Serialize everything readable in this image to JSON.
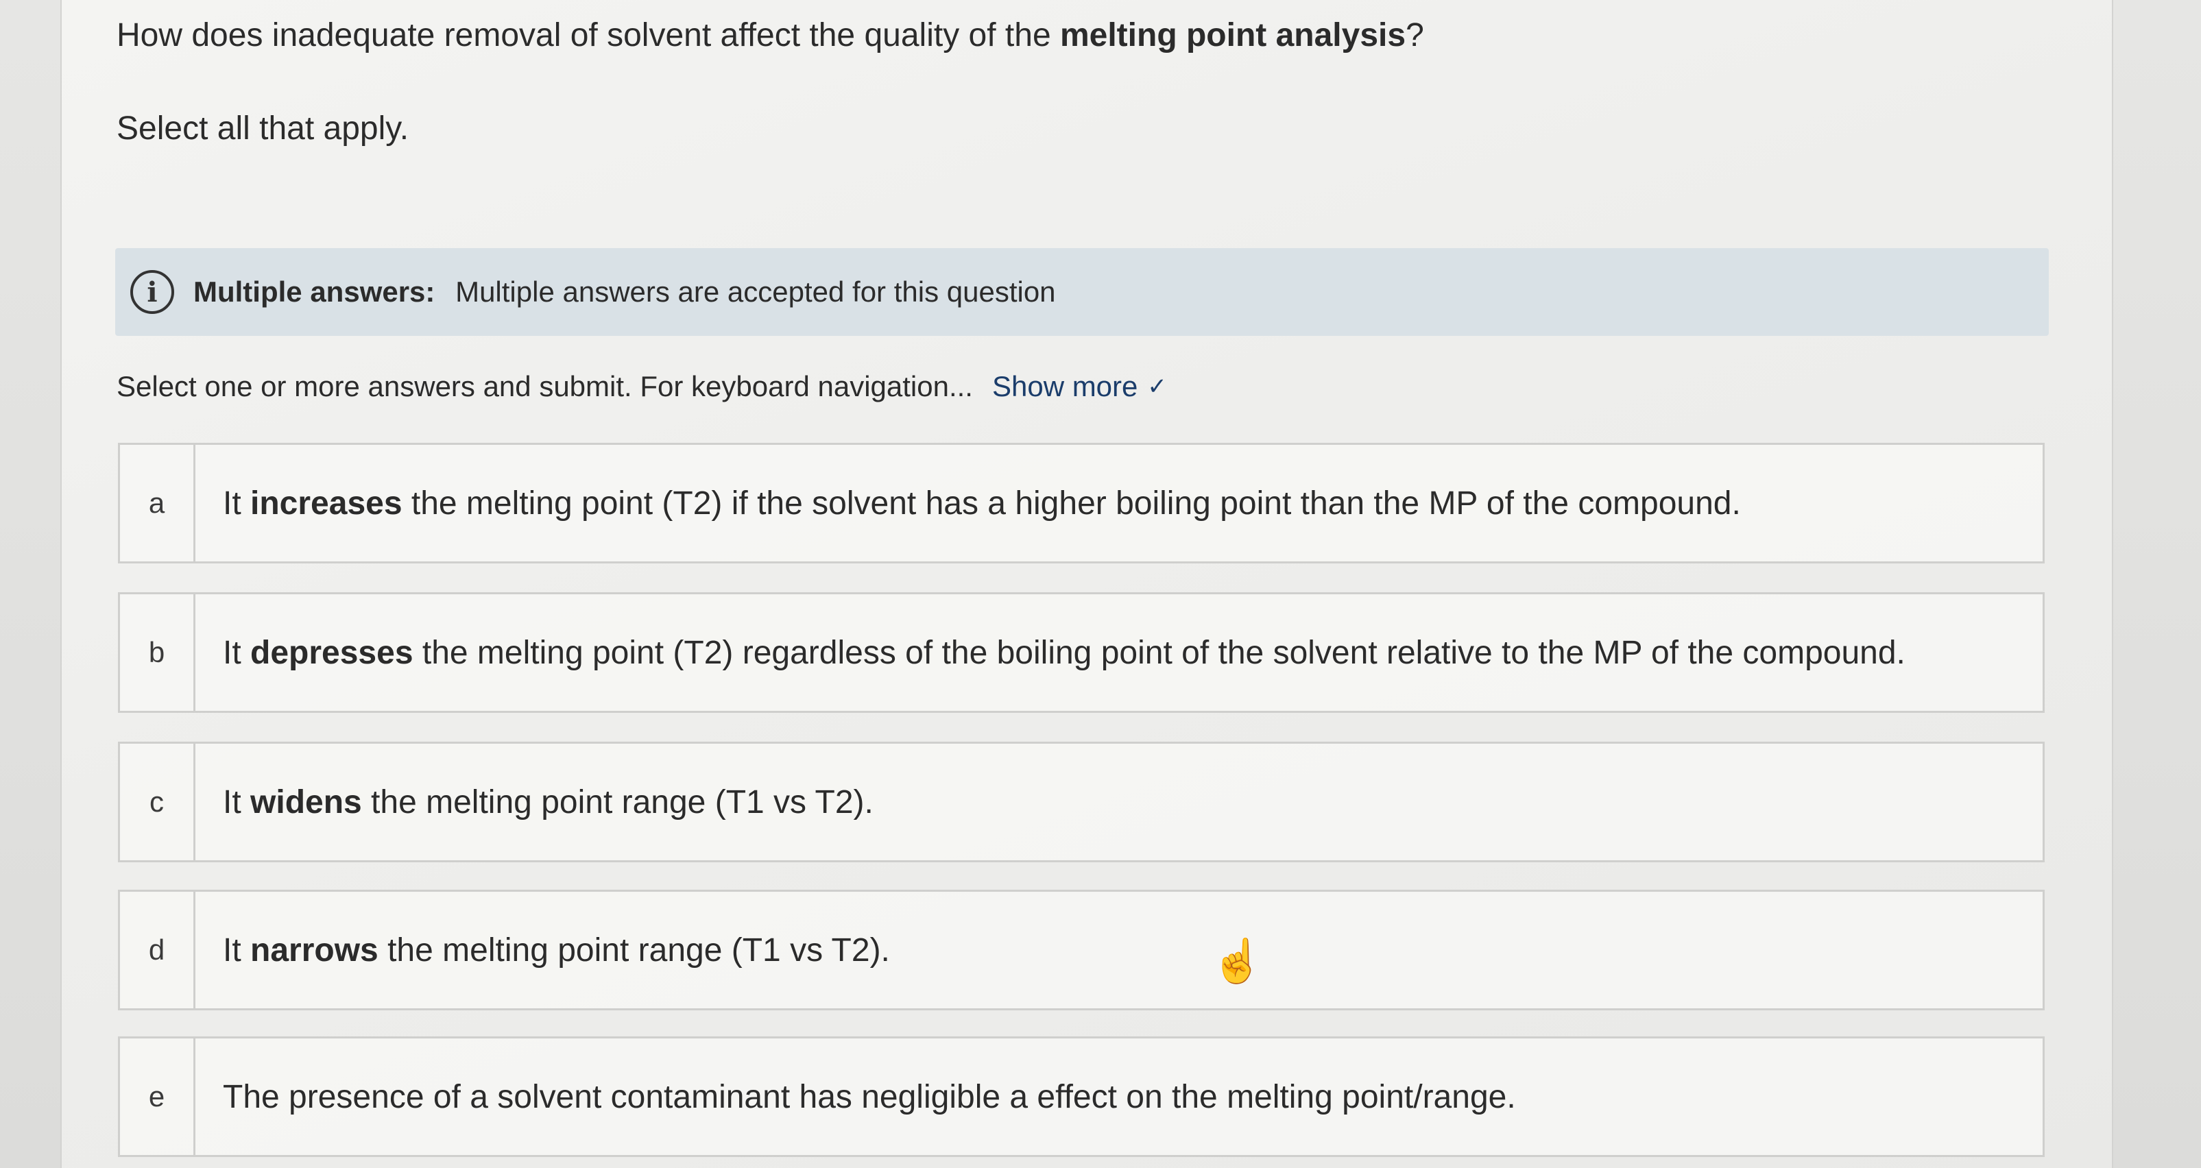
{
  "question": {
    "before": "How does inadequate removal of solvent affect the quality of the ",
    "bold": "melting point analysis",
    "after": "?"
  },
  "instruction": "Select all that apply.",
  "info": {
    "icon": "info-icon",
    "lead": "Multiple answers:",
    "text": "Multiple answers are accepted for this question"
  },
  "help": {
    "text": "Select one or more answers and submit. For keyboard navigation...",
    "show_more": "Show more",
    "chevron": "chevron-down-icon"
  },
  "options": [
    {
      "letter": "a",
      "pre": "It ",
      "bold": "increases",
      "post": " the melting point (T2) if the solvent has a higher boiling point than the MP of the compound."
    },
    {
      "letter": "b",
      "pre": "It ",
      "bold": "depresses",
      "post": " the melting point (T2) regardless of the boiling point of the solvent relative to the MP of the compound."
    },
    {
      "letter": "c",
      "pre": "It ",
      "bold": "widens",
      "post": " the melting point range (T1 vs T2)."
    },
    {
      "letter": "d",
      "pre": "It ",
      "bold": "narrows",
      "post": " the melting point range (T1 vs T2)."
    },
    {
      "letter": "e",
      "pre": "The presence of a solvent contaminant has negligible a effect on the melting point/range.",
      "bold": "",
      "post": ""
    }
  ]
}
